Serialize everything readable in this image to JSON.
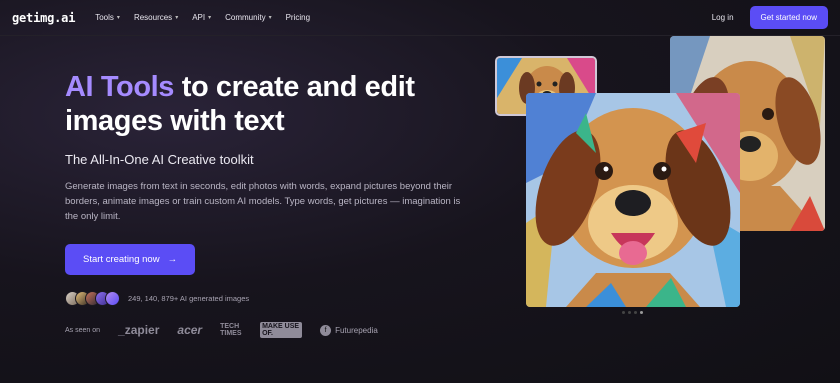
{
  "nav": {
    "logo": "getimg.ai",
    "items": [
      {
        "label": "Tools",
        "dropdown": true
      },
      {
        "label": "Resources",
        "dropdown": true
      },
      {
        "label": "API",
        "dropdown": true
      },
      {
        "label": "Community",
        "dropdown": true
      },
      {
        "label": "Pricing",
        "dropdown": false
      }
    ],
    "login": "Log in",
    "cta": "Get started now"
  },
  "hero": {
    "title_accent": "AI Tools",
    "title_rest": " to create and edit images with text",
    "subtitle": "The All-In-One AI Creative toolkit",
    "description": "Generate images from text in seconds, edit photos with words, expand pictures beyond their borders, animate images or train custom AI models. Type words, get pictures — imagination is the only limit.",
    "cta": "Start creating now",
    "cta_arrow": "→",
    "stats": "249, 140, 879+ AI generated images"
  },
  "seen_on": {
    "label": "As seen on",
    "brands": [
      "_zapier",
      "acer",
      "TECH TIMES",
      "MAKE USE OF.",
      "Futurepedia"
    ]
  },
  "gallery": {
    "images": [
      "dog-painting-small",
      "dog-painting-main",
      "dog-painting-back"
    ],
    "carousel_dots": 4,
    "active_dot": 3
  },
  "colors": {
    "accent": "#5b4df5",
    "title_accent": "#a58bff",
    "background": "#17141d"
  }
}
